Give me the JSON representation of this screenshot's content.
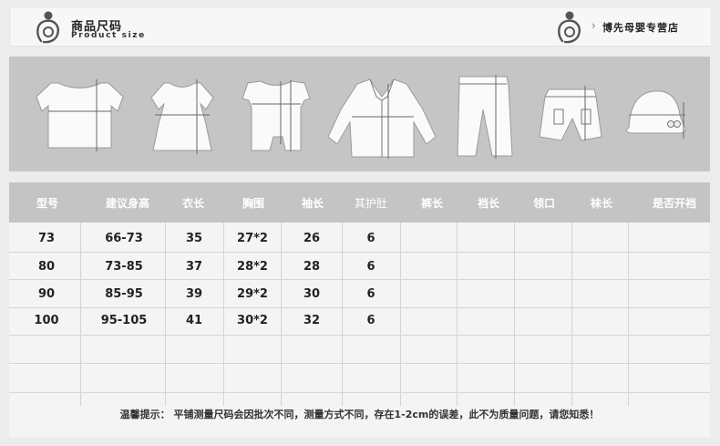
{
  "header": {
    "title_cn": "商品尺码",
    "title_en": "Product size",
    "store_name": "博先母婴专营店",
    "logo_icon": "baby-in-womb-logo-icon"
  },
  "garments": [
    "t-shirt-icon",
    "dress-icon",
    "romper-icon",
    "jacket-icon",
    "long-pants-icon",
    "shorts-icon",
    "hat-icon"
  ],
  "table": {
    "columns": [
      "型号",
      "建议身高",
      "衣长",
      "胸围",
      "袖长",
      "其护肚",
      "裤长",
      "裆长",
      "领口",
      "袜长",
      "是否开裆"
    ],
    "rows": [
      [
        "73",
        "66-73",
        "35",
        "27*2",
        "26",
        "6",
        "",
        "",
        "",
        "",
        ""
      ],
      [
        "80",
        "73-85",
        "37",
        "28*2",
        "28",
        "6",
        "",
        "",
        "",
        "",
        ""
      ],
      [
        "90",
        "85-95",
        "39",
        "29*2",
        "30",
        "6",
        "",
        "",
        "",
        "",
        ""
      ],
      [
        "100",
        "95-105",
        "41",
        "30*2",
        "32",
        "6",
        "",
        "",
        "",
        "",
        ""
      ],
      [
        "",
        "",
        "",
        "",
        "",
        "",
        "",
        "",
        "",
        "",
        ""
      ],
      [
        "",
        "",
        "",
        "",
        "",
        "",
        "",
        "",
        "",
        "",
        ""
      ]
    ]
  },
  "note": "温馨提示：  平铺测量尺码会因批次不同，测量方式不同，存在1-2cm的误差，此不为质量问题，请您知悉！"
}
